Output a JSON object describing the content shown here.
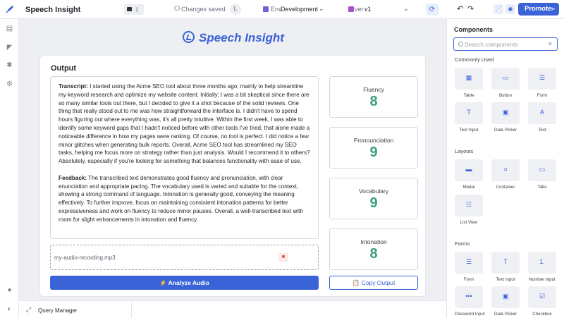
{
  "app": {
    "name": "Speech Insight"
  },
  "topbar": {
    "status": "Changes saved",
    "avatar_initial": "L",
    "env_key": "Env",
    "env_value": "Development",
    "version_key": "ver",
    "version_value": "v1",
    "promote_label": "Promote"
  },
  "canvas": {
    "banner_title": "Speech Insight",
    "card_title": "Output",
    "transcript_label": "Transcript:",
    "transcript": "I started using the Acme SEO tool about three months ago, mainly to help streamline my keyword research and optimize my website content. Initially, I was a bit skeptical since there are so many similar tools out there, but I decided to give it a shot because of the solid reviews. One thing that really stood out to me was how straightforward the interface is. I didn't have to spend hours figuring out where everything was, it's all pretty intuitive. Within the first week, I was able to identify some keyword gaps that I hadn't noticed before with other tools I've tried, that alone made a noticeable difference in how my pages were ranking. Of course, no tool is perfect. I did notice a few minor glitches when generating bulk reports. Overall, Acme SEO tool has streamlined my SEO tasks, helping me focus more on strategy rather than just analysis. Would I recommend it to others? Absolutely, especially if you're looking for something that balances functionality with ease of use.",
    "feedback_label": "Feedback:",
    "feedback": "The transcribed text demonstrates good fluency and pronunciation, with clear enunciation and appropriate pacing. The vocabulary used is varied and suitable for the context, showing a strong command of language. Intonation is generally good, conveying the meaning effectively. To further improve, focus on maintaining consistent intonation patterns for better expressiveness and work on fluency to reduce minor pauses. Overall, a well-transcribed text with room for slight enhancements in intonation and fluency.",
    "file_name": "my-audio-recording.mp3",
    "analyze_label": "⚡ Analyze Audio",
    "copy_label": "📋 Copy Output",
    "metrics": [
      {
        "label": "Fluency",
        "value": "8"
      },
      {
        "label": "Pronounciation",
        "value": "9"
      },
      {
        "label": "Vocabulary",
        "value": "9"
      },
      {
        "label": "Intonation",
        "value": "8"
      }
    ]
  },
  "bottombar": {
    "label": "Query Manager"
  },
  "panel": {
    "title": "Components",
    "search_placeholder": "Search components",
    "sections": [
      "Commonly Used",
      "Layouts",
      "Forms"
    ],
    "commonly_used": [
      "Table",
      "Button",
      "Form",
      "Text Input",
      "Date Picker",
      "Text"
    ],
    "layouts": [
      "Modal",
      "Container",
      "Tabs",
      "List View"
    ],
    "forms": [
      "Form",
      "Text Input",
      "Number Input",
      "Password Input",
      "Date Picker",
      "Checkbox"
    ]
  },
  "colors": {
    "accent": "#3b63d8",
    "score": "#37a07c",
    "canvas_bg": "#edeff3"
  }
}
